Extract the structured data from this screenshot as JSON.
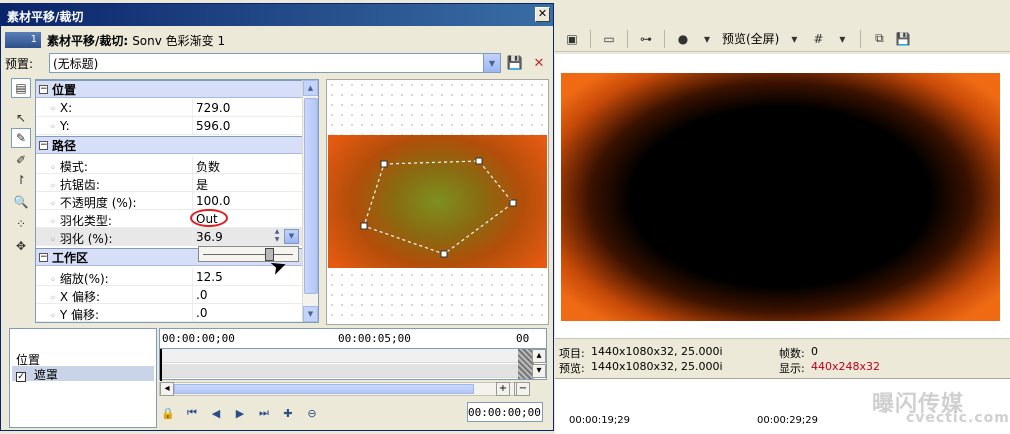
{
  "dialog": {
    "title": "素材平移/裁切",
    "close_glyph": "✕",
    "track_number": "1",
    "header_label": "素材平移/裁切:",
    "header_value": "Sonv 色彩渐变 1",
    "preset_label": "预置:",
    "preset_value": "(无标题)"
  },
  "toolbar_right": {
    "preview_mode": "预览(全屏)"
  },
  "properties": {
    "sections": {
      "position": "位置",
      "path": "路径",
      "workspace": "工作区"
    },
    "position_rows": [
      {
        "name": "X:",
        "value": "729.0"
      },
      {
        "name": "Y:",
        "value": "596.0"
      }
    ],
    "path_rows": [
      {
        "name": "模式:",
        "value": "负数"
      },
      {
        "name": "抗锯齿:",
        "value": "是"
      },
      {
        "name": "不透明度 (%):",
        "value": "100.0"
      },
      {
        "name": "羽化类型:",
        "value": "Out"
      },
      {
        "name": "羽化 (%):",
        "value": "36.9"
      }
    ],
    "workspace_rows": [
      {
        "name": "缩放(%):",
        "value": "12.5"
      },
      {
        "name": "X 偏移:",
        "value": ".0"
      },
      {
        "name": "Y 偏移:",
        "value": ".0"
      }
    ]
  },
  "keyframes": {
    "rows": [
      {
        "label": "位置",
        "checked": false
      },
      {
        "label": "遮罩",
        "checked": true
      }
    ],
    "ruler_ticks": [
      "00:00:00;00",
      "00:00:05;00",
      "00"
    ],
    "timecode": "00:00:00;00"
  },
  "preview_info": {
    "project_label": "项目:",
    "project_value": "1440x1080x32, 25.000i",
    "frames_label": "帧数:",
    "frames_value": "0",
    "preview_label": "预览:",
    "preview_value": "1440x1080x32, 25.000i",
    "display_label": "显示:",
    "display_value": "440x248x32"
  },
  "timeline": {
    "ticks": [
      "00:00:19;29",
      "00:00:29;29"
    ]
  },
  "watermark": {
    "text": "曝闪传媒",
    "sub": "cvectic.com"
  },
  "colors": {
    "title_bar": "#0a246a",
    "accent_red": "#e02020",
    "display_value_red": "#c0001a"
  }
}
